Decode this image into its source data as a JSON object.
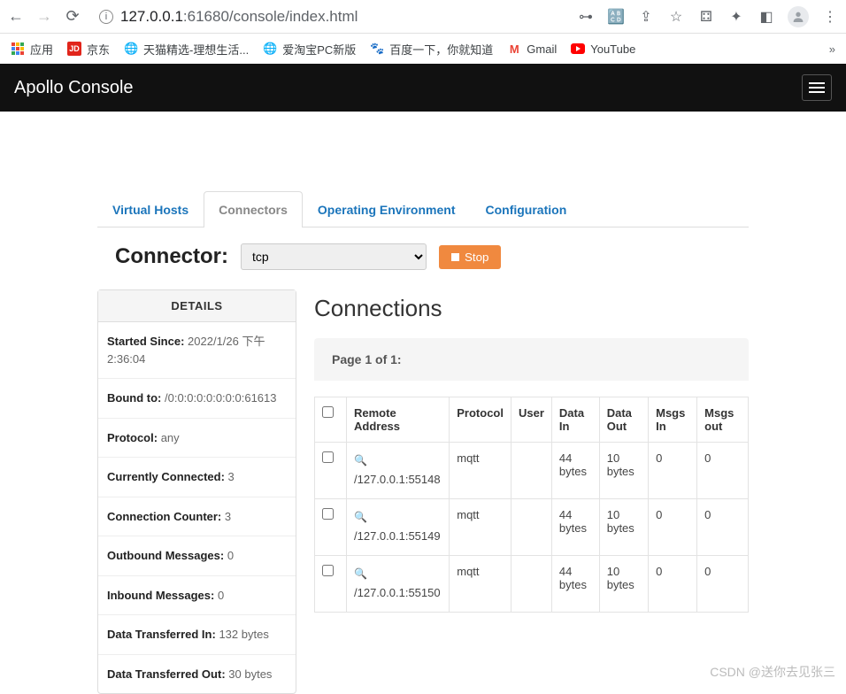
{
  "browser": {
    "url_host": "127.0.0.1",
    "url_port": ":61680",
    "url_path": "/console/index.html",
    "bookmarks": {
      "apps": "应用",
      "jd": "京东",
      "tmall": "天猫精选-理想生活...",
      "aitaobao": "爱淘宝PC新版",
      "baidu": "百度一下，你就知道",
      "gmail": "Gmail",
      "youtube": "YouTube"
    }
  },
  "app": {
    "title": "Apollo Console"
  },
  "tabs": {
    "vhosts": "Virtual Hosts",
    "connectors": "Connectors",
    "openv": "Operating Environment",
    "config": "Configuration"
  },
  "connector": {
    "label": "Connector:",
    "selected": "tcp",
    "stop": "Stop"
  },
  "details": {
    "header": "DETAILS",
    "items": [
      {
        "label": "Started Since:",
        "value": "2022/1/26 下午2:36:04"
      },
      {
        "label": "Bound to:",
        "value": "/0:0:0:0:0:0:0:0:61613"
      },
      {
        "label": "Protocol:",
        "value": "any"
      },
      {
        "label": "Currently Connected:",
        "value": "3"
      },
      {
        "label": "Connection Counter:",
        "value": "3"
      },
      {
        "label": "Outbound Messages:",
        "value": "0"
      },
      {
        "label": "Inbound Messages:",
        "value": "0"
      },
      {
        "label": "Data Transferred In:",
        "value": "132 bytes"
      },
      {
        "label": "Data Transferred Out:",
        "value": "30 bytes"
      }
    ]
  },
  "connections": {
    "title": "Connections",
    "pager": "Page 1 of 1:",
    "headers": {
      "remote": "Remote Address",
      "protocol": "Protocol",
      "user": "User",
      "din": "Data In",
      "dout": "Data Out",
      "min": "Msgs In",
      "mout": "Msgs out"
    },
    "rows": [
      {
        "remote": "/127.0.0.1:55148",
        "protocol": "mqtt",
        "user": "",
        "din": "44 bytes",
        "dout": "10 bytes",
        "min": "0",
        "mout": "0"
      },
      {
        "remote": "/127.0.0.1:55149",
        "protocol": "mqtt",
        "user": "",
        "din": "44 bytes",
        "dout": "10 bytes",
        "min": "0",
        "mout": "0"
      },
      {
        "remote": "/127.0.0.1:55150",
        "protocol": "mqtt",
        "user": "",
        "din": "44 bytes",
        "dout": "10 bytes",
        "min": "0",
        "mout": "0"
      }
    ]
  },
  "watermark": "CSDN @送你去见张三"
}
